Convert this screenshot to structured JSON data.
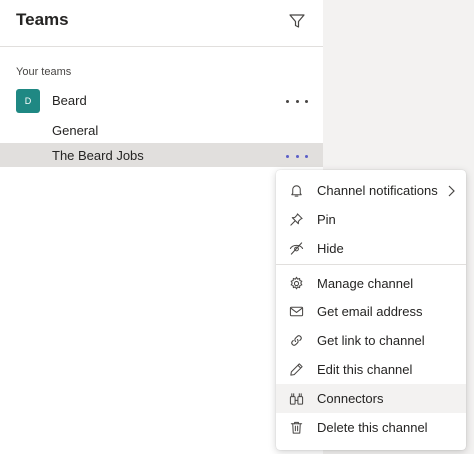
{
  "header": {
    "title": "Teams"
  },
  "section_label": "Your teams",
  "team": {
    "avatar_initial": "D",
    "name": "Beard",
    "channels": [
      "General",
      "The Beard Jobs"
    ]
  },
  "menu": {
    "items": [
      {
        "label": "Channel notifications",
        "icon": "bell-icon",
        "submenu": true
      },
      {
        "label": "Pin",
        "icon": "pin-icon"
      },
      {
        "label": "Hide",
        "icon": "eye-slash-icon"
      },
      {
        "label": "Manage channel",
        "icon": "gear-icon"
      },
      {
        "label": "Get email address",
        "icon": "envelope-icon"
      },
      {
        "label": "Get link to channel",
        "icon": "link-icon"
      },
      {
        "label": "Edit this channel",
        "icon": "pencil-icon"
      },
      {
        "label": "Connectors",
        "icon": "connectors-icon"
      },
      {
        "label": "Delete this channel",
        "icon": "trash-icon"
      }
    ]
  },
  "colors": {
    "avatar": "#1f8883",
    "accent": "#5b5fc7",
    "selected_row": "#e1dfdd"
  }
}
